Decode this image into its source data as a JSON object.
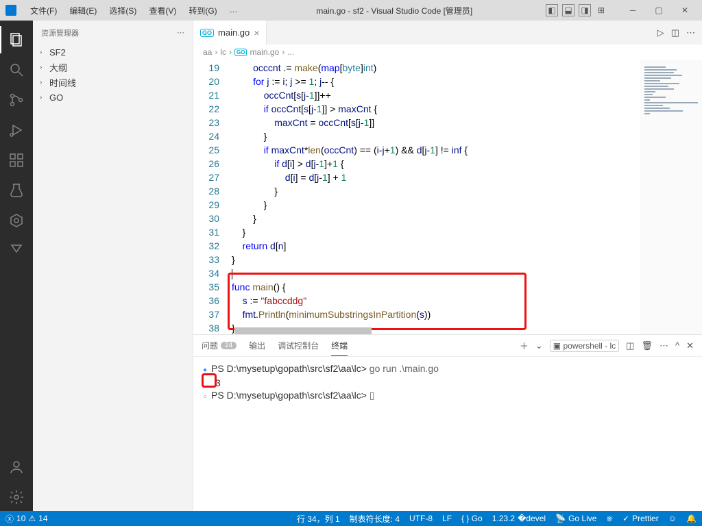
{
  "title": "main.go - sf2 - Visual Studio Code [管理员]",
  "menu": [
    "文件(F)",
    "编辑(E)",
    "选择(S)",
    "查看(V)",
    "转到(G)",
    "…"
  ],
  "sidebar": {
    "title": "资源管理器",
    "items": [
      "SF2",
      "大纲",
      "时间线",
      "GO"
    ]
  },
  "tab": {
    "name": "main.go"
  },
  "breadcrumbs": [
    "aa",
    "lc",
    "main.go",
    "..."
  ],
  "gutter_start": 19,
  "code_lines": [
    {
      "html": "        <span class='id'>occcnt</span> .= <span class='fn'>make</span>(<span class='kw'>map</span>[<span class='typ'>byte</span>]<span class='typ'>int</span>)"
    },
    {
      "html": "        <span class='kw'>for</span> <span class='id'>j</span> := <span class='id'>i</span>; <span class='id'>j</span> &gt;= <span class='num'>1</span>; <span class='id'>j</span>-- {"
    },
    {
      "html": "            <span class='id'>occCnt</span>[<span class='id'>s</span>[<span class='id'>j</span>-<span class='num'>1</span>]]++"
    },
    {
      "html": "            <span class='kw'>if</span> <span class='id'>occCnt</span>[<span class='id'>s</span>[<span class='id'>j</span>-<span class='num'>1</span>]] &gt; <span class='id'>maxCnt</span> {"
    },
    {
      "html": "                <span class='id'>maxCnt</span> = <span class='id'>occCnt</span>[<span class='id'>s</span>[<span class='id'>j</span>-<span class='num'>1</span>]]"
    },
    {
      "html": "            }"
    },
    {
      "html": "            <span class='kw'>if</span> <span class='id'>maxCnt</span>*<span class='fn'>len</span>(<span class='id'>occCnt</span>) == (<span class='id'>i</span>-<span class='id'>j</span>+<span class='num'>1</span>) &amp;&amp; <span class='id'>d</span>[<span class='id'>j</span>-<span class='num'>1</span>] != <span class='id'>inf</span> {"
    },
    {
      "html": "                <span class='kw'>if</span> <span class='id'>d</span>[<span class='id'>i</span>] &gt; <span class='id'>d</span>[<span class='id'>j</span>-<span class='num'>1</span>]+<span class='num'>1</span> {"
    },
    {
      "html": "                    <span class='id'>d</span>[<span class='id'>i</span>] = <span class='id'>d</span>[<span class='id'>j</span>-<span class='num'>1</span>] + <span class='num'>1</span>"
    },
    {
      "html": "                }"
    },
    {
      "html": "            }"
    },
    {
      "html": "        }"
    },
    {
      "html": "    }"
    },
    {
      "html": "    <span class='kw'>return</span> <span class='id'>d</span>[<span class='id'>n</span>]"
    },
    {
      "html": "}"
    },
    {
      "html": "<span class='cursor-line'></span>"
    },
    {
      "html": "<span class='kw'>func</span> <span class='fn'>main</span>() {"
    },
    {
      "html": "    <span class='id'>s</span> := <span class='str'>\"fabccddg\"</span>"
    },
    {
      "html": "    <span class='id'>fmt</span>.<span class='fn'>Println</span>(<span class='fn'>minimumSubstringsInPartition</span>(<span class='id'>s</span>))"
    },
    {
      "html": "}"
    }
  ],
  "panel": {
    "tabs": {
      "problems": "问题",
      "problems_count": "24",
      "output": "输出",
      "debug": "调试控制台",
      "terminal": "终端"
    },
    "shell_label": "powershell - lc",
    "lines": [
      {
        "cls": "term-dot-blue",
        "prompt": "PS D:\\mysetup\\gopath\\src\\sf2\\aa\\lc> ",
        "cmd": "go run .\\main.go"
      },
      {
        "cls": "",
        "text": "3"
      },
      {
        "cls": "term-dot-grey",
        "prompt": "PS D:\\mysetup\\gopath\\src\\sf2\\aa\\lc> ",
        "cmd": "▯"
      }
    ]
  },
  "status": {
    "errors": "10",
    "warnings": "14",
    "pos": "行 34，列 1",
    "tab": "制表符长度: 4",
    "enc": "UTF-8",
    "eol": "LF",
    "lang": "{ } Go",
    "ver": "1.23.2",
    "golive": "Go Live",
    "prettier": "Prettier"
  }
}
